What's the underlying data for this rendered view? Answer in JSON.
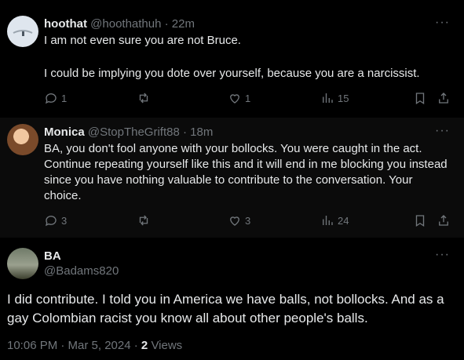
{
  "tweets": [
    {
      "name": "hoothat",
      "handle": "@hoothathuh",
      "time": "· 22m",
      "text1": "I am not even sure you are not Bruce.",
      "text2": "I could be implying you dote over yourself, because you are a narcissist.",
      "replies": "1",
      "reposts": "",
      "likes": "1",
      "views": "15"
    },
    {
      "name": "Monica",
      "handle": "@StopTheGrift88",
      "time": "· 18m",
      "text1": "BA, you don't fool anyone with your bollocks. You were caught in the act. Continue repeating yourself like this and it will end in me blocking you instead since you have nothing valuable to contribute to the conversation. Your choice.",
      "replies": "3",
      "reposts": "",
      "likes": "3",
      "views": "24"
    }
  ],
  "main": {
    "name": "BA",
    "handle": "@Badams820",
    "text": "I did contribute. I told you in America we have balls, not bollocks. And as a gay Colombian racist you know all about other people's balls.",
    "timestamp": "10:06 PM · Mar 5, 2024 · ",
    "views_count": "2",
    "views_label": "Views"
  },
  "more_label": "···"
}
